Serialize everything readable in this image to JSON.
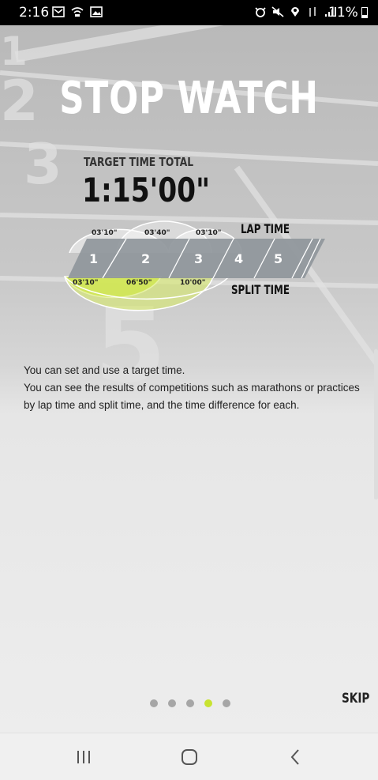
{
  "status_bar": {
    "time": "2:16",
    "battery": "11%",
    "left_icons": [
      "email-icon",
      "wifi-call-icon",
      "image-icon"
    ],
    "right_icons": [
      "alarm-icon",
      "mute-icon",
      "location-icon",
      "data-icon",
      "signal-icon"
    ]
  },
  "title": "STOP WATCH",
  "target": {
    "label": "TARGET TIME TOTAL",
    "value": "1:15'00\""
  },
  "diagram": {
    "lap_label": "LAP TIME",
    "split_label": "SPLIT TIME",
    "laps": [
      "1",
      "2",
      "3",
      "4",
      "5"
    ],
    "lap_times": [
      "03'10\"",
      "03'40\"",
      "03'10\""
    ],
    "split_times": [
      "03'10\"",
      "06'50\"",
      "10'00\""
    ],
    "accent_color": "#c8e330"
  },
  "description": [
    "You can set and use a target time.",
    "You can see the results of competitions such as marathons or practices",
    "by lap time and split time, and the time difference for each."
  ],
  "pager": {
    "count": 5,
    "active_index": 3
  },
  "skip_label": "SKIP",
  "nav": {
    "recents": "recent-apps-icon",
    "home": "home-icon",
    "back": "back-icon"
  }
}
